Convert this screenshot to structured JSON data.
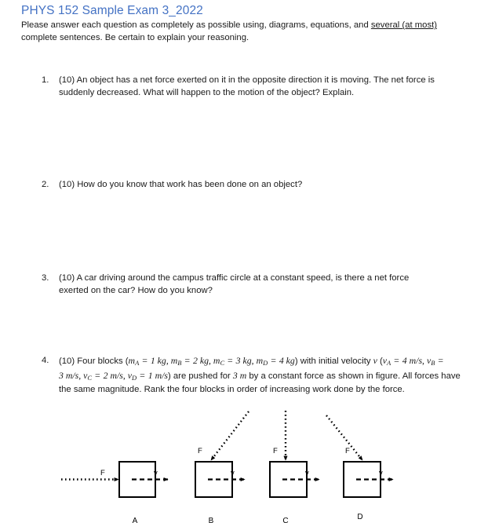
{
  "document": {
    "title": "PHYS 152 Sample Exam 3_2022",
    "title_color": "#4472c4",
    "instructions_part1": "Please answer each question as completely as possible using, diagrams, equations, and ",
    "instructions_underlined": "several (at most)",
    "instructions_part2": " complete sentences.  Be certain to explain your reasoning."
  },
  "questions": [
    {
      "number": "1.",
      "points": "(10)",
      "text": "(10) An object has a net force exerted on it in the opposite direction it is moving.  The net force is suddenly decreased.  What will happen to the motion of the object?  Explain."
    },
    {
      "number": "2.",
      "points": "(10)",
      "text": "(10) How do you know that work has been done on an object?"
    },
    {
      "number": "3.",
      "points": "(10)",
      "text": "(10) A car driving around the campus traffic circle at a constant speed, is there a net force exerted on the car?  How do you know?"
    },
    {
      "number": "4.",
      "points": "(10)",
      "lead": "(10) Four blocks (",
      "masses": [
        {
          "sym": "m",
          "sub": "A",
          "val": "1",
          "unit": "kg"
        },
        {
          "sym": "m",
          "sub": "B",
          "val": "2",
          "unit": "kg"
        },
        {
          "sym": "m",
          "sub": "C",
          "val": "3",
          "unit": "kg"
        },
        {
          "sym": "m",
          "sub": "D",
          "val": "4",
          "unit": "kg"
        }
      ],
      "mid1": ") with initial velocity ",
      "vel_symbol": "v",
      "velocities": [
        {
          "sym": "v",
          "sub": "A",
          "val": "4",
          "unit": "m/s"
        },
        {
          "sym": "v",
          "sub": "B",
          "val": "3",
          "unit": "m/s"
        },
        {
          "sym": "v",
          "sub": "C",
          "val": "2",
          "unit": "m/s"
        },
        {
          "sym": "v",
          "sub": "D",
          "val": "1",
          "unit": "m/s"
        }
      ],
      "mid2": ") are pushed for ",
      "distance": "3",
      "distance_unit": "m",
      "mid3": " by a constant force as shown in figure. All forces have the same magnitude. Rank the four blocks in order of increasing work done by the force."
    }
  ],
  "figure": {
    "force_label": "F",
    "velocity_label": "v",
    "blocks": [
      {
        "label": "A",
        "force_direction": "horizontal-right"
      },
      {
        "label": "B",
        "force_direction": "diagonal-from-upper-right"
      },
      {
        "label": "C",
        "force_direction": "vertical-down"
      },
      {
        "label": "D",
        "force_direction": "diagonal-from-upper-left"
      }
    ]
  }
}
